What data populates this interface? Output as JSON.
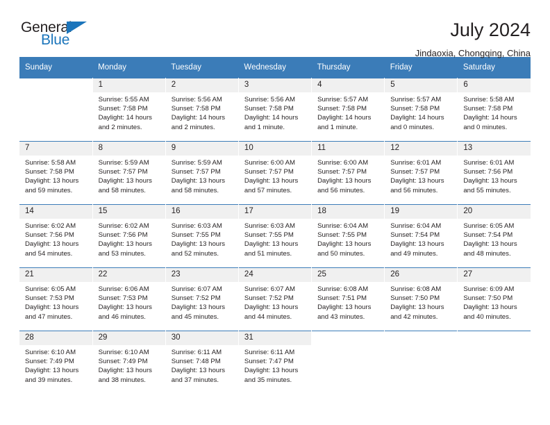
{
  "logo": {
    "word_top": "General",
    "word_bottom": "Blue",
    "triangle_color": "#1b75bb",
    "icon": "general-blue-logo"
  },
  "header": {
    "title": "July 2024",
    "location": "Jindaoxia, Chongqing, China"
  },
  "theme": {
    "header_row_bg": "#3b7cb8",
    "daynum_bg": "#f0f0f0",
    "text": "#231f20",
    "cell_bg": "#ffffff"
  },
  "weekday_headers": [
    "Sunday",
    "Monday",
    "Tuesday",
    "Wednesday",
    "Thursday",
    "Friday",
    "Saturday"
  ],
  "labels": {
    "sunrise_prefix": "Sunrise:",
    "sunset_prefix": "Sunset:",
    "daylight_prefix": "Daylight:"
  },
  "weeks": [
    [
      {
        "day": "",
        "l1": "",
        "l2": "",
        "l3": "",
        "l4": ""
      },
      {
        "day": "1",
        "l1": "Sunrise: 5:55 AM",
        "l2": "Sunset: 7:58 PM",
        "l3": "Daylight: 14 hours",
        "l4": "and 2 minutes."
      },
      {
        "day": "2",
        "l1": "Sunrise: 5:56 AM",
        "l2": "Sunset: 7:58 PM",
        "l3": "Daylight: 14 hours",
        "l4": "and 2 minutes."
      },
      {
        "day": "3",
        "l1": "Sunrise: 5:56 AM",
        "l2": "Sunset: 7:58 PM",
        "l3": "Daylight: 14 hours",
        "l4": "and 1 minute."
      },
      {
        "day": "4",
        "l1": "Sunrise: 5:57 AM",
        "l2": "Sunset: 7:58 PM",
        "l3": "Daylight: 14 hours",
        "l4": "and 1 minute."
      },
      {
        "day": "5",
        "l1": "Sunrise: 5:57 AM",
        "l2": "Sunset: 7:58 PM",
        "l3": "Daylight: 14 hours",
        "l4": "and 0 minutes."
      },
      {
        "day": "6",
        "l1": "Sunrise: 5:58 AM",
        "l2": "Sunset: 7:58 PM",
        "l3": "Daylight: 14 hours",
        "l4": "and 0 minutes."
      }
    ],
    [
      {
        "day": "7",
        "l1": "Sunrise: 5:58 AM",
        "l2": "Sunset: 7:58 PM",
        "l3": "Daylight: 13 hours",
        "l4": "and 59 minutes."
      },
      {
        "day": "8",
        "l1": "Sunrise: 5:59 AM",
        "l2": "Sunset: 7:57 PM",
        "l3": "Daylight: 13 hours",
        "l4": "and 58 minutes."
      },
      {
        "day": "9",
        "l1": "Sunrise: 5:59 AM",
        "l2": "Sunset: 7:57 PM",
        "l3": "Daylight: 13 hours",
        "l4": "and 58 minutes."
      },
      {
        "day": "10",
        "l1": "Sunrise: 6:00 AM",
        "l2": "Sunset: 7:57 PM",
        "l3": "Daylight: 13 hours",
        "l4": "and 57 minutes."
      },
      {
        "day": "11",
        "l1": "Sunrise: 6:00 AM",
        "l2": "Sunset: 7:57 PM",
        "l3": "Daylight: 13 hours",
        "l4": "and 56 minutes."
      },
      {
        "day": "12",
        "l1": "Sunrise: 6:01 AM",
        "l2": "Sunset: 7:57 PM",
        "l3": "Daylight: 13 hours",
        "l4": "and 56 minutes."
      },
      {
        "day": "13",
        "l1": "Sunrise: 6:01 AM",
        "l2": "Sunset: 7:56 PM",
        "l3": "Daylight: 13 hours",
        "l4": "and 55 minutes."
      }
    ],
    [
      {
        "day": "14",
        "l1": "Sunrise: 6:02 AM",
        "l2": "Sunset: 7:56 PM",
        "l3": "Daylight: 13 hours",
        "l4": "and 54 minutes."
      },
      {
        "day": "15",
        "l1": "Sunrise: 6:02 AM",
        "l2": "Sunset: 7:56 PM",
        "l3": "Daylight: 13 hours",
        "l4": "and 53 minutes."
      },
      {
        "day": "16",
        "l1": "Sunrise: 6:03 AM",
        "l2": "Sunset: 7:55 PM",
        "l3": "Daylight: 13 hours",
        "l4": "and 52 minutes."
      },
      {
        "day": "17",
        "l1": "Sunrise: 6:03 AM",
        "l2": "Sunset: 7:55 PM",
        "l3": "Daylight: 13 hours",
        "l4": "and 51 minutes."
      },
      {
        "day": "18",
        "l1": "Sunrise: 6:04 AM",
        "l2": "Sunset: 7:55 PM",
        "l3": "Daylight: 13 hours",
        "l4": "and 50 minutes."
      },
      {
        "day": "19",
        "l1": "Sunrise: 6:04 AM",
        "l2": "Sunset: 7:54 PM",
        "l3": "Daylight: 13 hours",
        "l4": "and 49 minutes."
      },
      {
        "day": "20",
        "l1": "Sunrise: 6:05 AM",
        "l2": "Sunset: 7:54 PM",
        "l3": "Daylight: 13 hours",
        "l4": "and 48 minutes."
      }
    ],
    [
      {
        "day": "21",
        "l1": "Sunrise: 6:05 AM",
        "l2": "Sunset: 7:53 PM",
        "l3": "Daylight: 13 hours",
        "l4": "and 47 minutes."
      },
      {
        "day": "22",
        "l1": "Sunrise: 6:06 AM",
        "l2": "Sunset: 7:53 PM",
        "l3": "Daylight: 13 hours",
        "l4": "and 46 minutes."
      },
      {
        "day": "23",
        "l1": "Sunrise: 6:07 AM",
        "l2": "Sunset: 7:52 PM",
        "l3": "Daylight: 13 hours",
        "l4": "and 45 minutes."
      },
      {
        "day": "24",
        "l1": "Sunrise: 6:07 AM",
        "l2": "Sunset: 7:52 PM",
        "l3": "Daylight: 13 hours",
        "l4": "and 44 minutes."
      },
      {
        "day": "25",
        "l1": "Sunrise: 6:08 AM",
        "l2": "Sunset: 7:51 PM",
        "l3": "Daylight: 13 hours",
        "l4": "and 43 minutes."
      },
      {
        "day": "26",
        "l1": "Sunrise: 6:08 AM",
        "l2": "Sunset: 7:50 PM",
        "l3": "Daylight: 13 hours",
        "l4": "and 42 minutes."
      },
      {
        "day": "27",
        "l1": "Sunrise: 6:09 AM",
        "l2": "Sunset: 7:50 PM",
        "l3": "Daylight: 13 hours",
        "l4": "and 40 minutes."
      }
    ],
    [
      {
        "day": "28",
        "l1": "Sunrise: 6:10 AM",
        "l2": "Sunset: 7:49 PM",
        "l3": "Daylight: 13 hours",
        "l4": "and 39 minutes."
      },
      {
        "day": "29",
        "l1": "Sunrise: 6:10 AM",
        "l2": "Sunset: 7:49 PM",
        "l3": "Daylight: 13 hours",
        "l4": "and 38 minutes."
      },
      {
        "day": "30",
        "l1": "Sunrise: 6:11 AM",
        "l2": "Sunset: 7:48 PM",
        "l3": "Daylight: 13 hours",
        "l4": "and 37 minutes."
      },
      {
        "day": "31",
        "l1": "Sunrise: 6:11 AM",
        "l2": "Sunset: 7:47 PM",
        "l3": "Daylight: 13 hours",
        "l4": "and 35 minutes."
      },
      {
        "day": "",
        "l1": "",
        "l2": "",
        "l3": "",
        "l4": ""
      },
      {
        "day": "",
        "l1": "",
        "l2": "",
        "l3": "",
        "l4": ""
      },
      {
        "day": "",
        "l1": "",
        "l2": "",
        "l3": "",
        "l4": ""
      }
    ]
  ]
}
